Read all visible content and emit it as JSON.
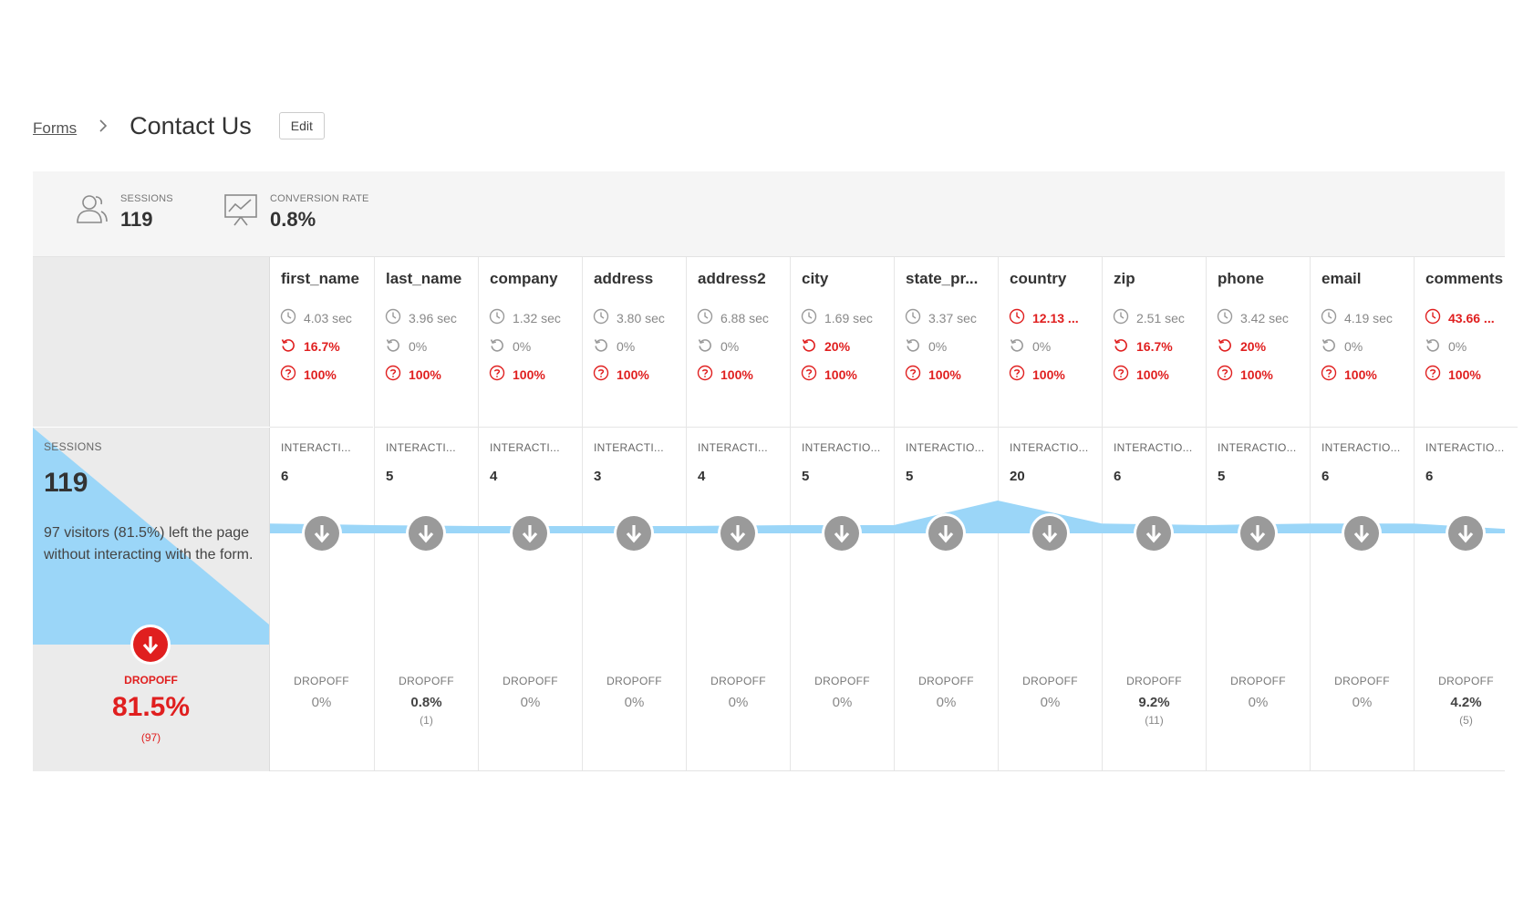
{
  "breadcrumb": {
    "parent": "Forms",
    "title": "Contact Us",
    "edit_label": "Edit"
  },
  "summary": {
    "sessions_label": "SESSIONS",
    "sessions_value": "119",
    "conversion_label": "CONVERSION RATE",
    "conversion_value": "0.8%"
  },
  "overview": {
    "label": "SESSIONS",
    "value": "119",
    "description": "97 visitors (81.5%) left the page without interacting with the form.",
    "dropoff_label": "DROPOFF",
    "dropoff_pct": "81.5%",
    "dropoff_count": "(97)",
    "dropoff_fraction": 0.815
  },
  "colors": {
    "accent_blue": "#9bd6f8",
    "alert_red": "#e01f1f",
    "neutral_gray": "#9a9a9a"
  },
  "fields": [
    {
      "name": "first_name",
      "time": "4.03 sec",
      "time_hi": false,
      "refill": "16.7%",
      "refill_hi": true,
      "blank": "100%",
      "int_label": "INTERACTI...",
      "interactions": "6",
      "interactions_num": 6,
      "drop_label": "DROPOFF",
      "drop_pct": "0%",
      "drop_count": "",
      "drop_hi": false
    },
    {
      "name": "last_name",
      "time": "3.96 sec",
      "time_hi": false,
      "refill": "0%",
      "refill_hi": false,
      "blank": "100%",
      "int_label": "INTERACTI...",
      "interactions": "5",
      "interactions_num": 5,
      "drop_label": "DROPOFF",
      "drop_pct": "0.8%",
      "drop_count": "(1)",
      "drop_hi": true
    },
    {
      "name": "company",
      "time": "1.32 sec",
      "time_hi": false,
      "refill": "0%",
      "refill_hi": false,
      "blank": "100%",
      "int_label": "INTERACTI...",
      "interactions": "4",
      "interactions_num": 4,
      "drop_label": "DROPOFF",
      "drop_pct": "0%",
      "drop_count": "",
      "drop_hi": false
    },
    {
      "name": "address",
      "time": "3.80 sec",
      "time_hi": false,
      "refill": "0%",
      "refill_hi": false,
      "blank": "100%",
      "int_label": "INTERACTI...",
      "interactions": "3",
      "interactions_num": 3,
      "drop_label": "DROPOFF",
      "drop_pct": "0%",
      "drop_count": "",
      "drop_hi": false
    },
    {
      "name": "address2",
      "time": "6.88 sec",
      "time_hi": false,
      "refill": "0%",
      "refill_hi": false,
      "blank": "100%",
      "int_label": "INTERACTI...",
      "interactions": "4",
      "interactions_num": 4,
      "drop_label": "DROPOFF",
      "drop_pct": "0%",
      "drop_count": "",
      "drop_hi": false
    },
    {
      "name": "city",
      "time": "1.69 sec",
      "time_hi": false,
      "refill": "20%",
      "refill_hi": true,
      "blank": "100%",
      "int_label": "INTERACTIO...",
      "interactions": "5",
      "interactions_num": 5,
      "drop_label": "DROPOFF",
      "drop_pct": "0%",
      "drop_count": "",
      "drop_hi": false
    },
    {
      "name": "state_pr...",
      "time": "3.37 sec",
      "time_hi": false,
      "refill": "0%",
      "refill_hi": false,
      "blank": "100%",
      "int_label": "INTERACTIO...",
      "interactions": "5",
      "interactions_num": 5,
      "drop_label": "DROPOFF",
      "drop_pct": "0%",
      "drop_count": "",
      "drop_hi": false
    },
    {
      "name": "country",
      "time": "12.13 ...",
      "time_hi": true,
      "refill": "0%",
      "refill_hi": false,
      "blank": "100%",
      "int_label": "INTERACTIO...",
      "interactions": "20",
      "interactions_num": 20,
      "drop_label": "DROPOFF",
      "drop_pct": "0%",
      "drop_count": "",
      "drop_hi": false
    },
    {
      "name": "zip",
      "time": "2.51 sec",
      "time_hi": false,
      "refill": "16.7%",
      "refill_hi": true,
      "blank": "100%",
      "int_label": "INTERACTIO...",
      "interactions": "6",
      "interactions_num": 6,
      "drop_label": "DROPOFF",
      "drop_pct": "9.2%",
      "drop_count": "(11)",
      "drop_hi": true
    },
    {
      "name": "phone",
      "time": "3.42 sec",
      "time_hi": false,
      "refill": "20%",
      "refill_hi": true,
      "blank": "100%",
      "int_label": "INTERACTIO...",
      "interactions": "5",
      "interactions_num": 5,
      "drop_label": "DROPOFF",
      "drop_pct": "0%",
      "drop_count": "",
      "drop_hi": false
    },
    {
      "name": "email",
      "time": "4.19 sec",
      "time_hi": false,
      "refill": "0%",
      "refill_hi": false,
      "blank": "100%",
      "int_label": "INTERACTIO...",
      "interactions": "6",
      "interactions_num": 6,
      "drop_label": "DROPOFF",
      "drop_pct": "0%",
      "drop_count": "",
      "drop_hi": false
    },
    {
      "name": "comments",
      "time": "43.66 ...",
      "time_hi": true,
      "refill": "0%",
      "refill_hi": false,
      "blank": "100%",
      "int_label": "INTERACTIO...",
      "interactions": "6",
      "interactions_num": 6,
      "drop_label": "DROPOFF",
      "drop_pct": "4.2%",
      "drop_count": "(5)",
      "drop_hi": true
    }
  ]
}
